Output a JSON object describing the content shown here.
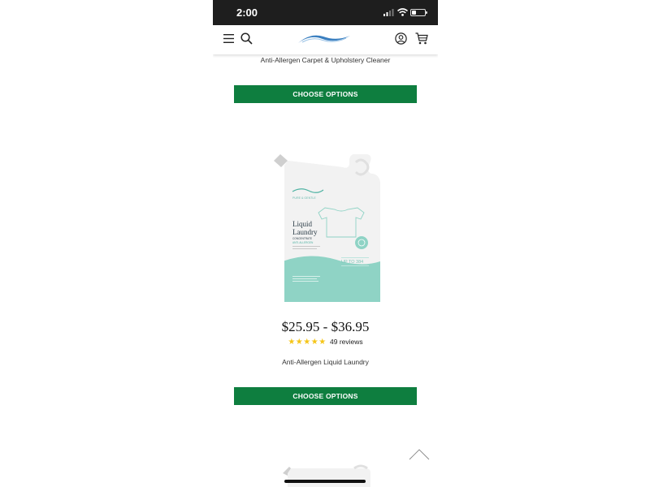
{
  "status_bar": {
    "time": "2:00"
  },
  "header": {
    "menu_icon": "hamburger-icon",
    "search_icon": "search-icon",
    "logo_icon": "wave-logo",
    "account_icon": "user-circle-icon",
    "cart_icon": "cart-icon"
  },
  "products": [
    {
      "name": "Anti-Allergen Carpet & Upholstery Cleaner",
      "button_label": "CHOOSE OPTIONS"
    },
    {
      "name": "Anti-Allergen Liquid Laundry",
      "price": "$25.95 - $36.95",
      "stars": "★★★★★",
      "rating": 5,
      "reviews": "49 reviews",
      "button_label": "CHOOSE OPTIONS",
      "image": {
        "brand": "PURE & GENTLE",
        "title_line1": "Liquid",
        "title_line2": "Laundry",
        "subtitle": "CONCENTRATE",
        "tag": "ANTI-ALLERGEN",
        "loads": "UP TO 384"
      }
    }
  ],
  "colors": {
    "button": "#0e7e3f",
    "stars": "#f5c518",
    "accent": "#8fd3c5",
    "logo": "#3a7fc0"
  }
}
